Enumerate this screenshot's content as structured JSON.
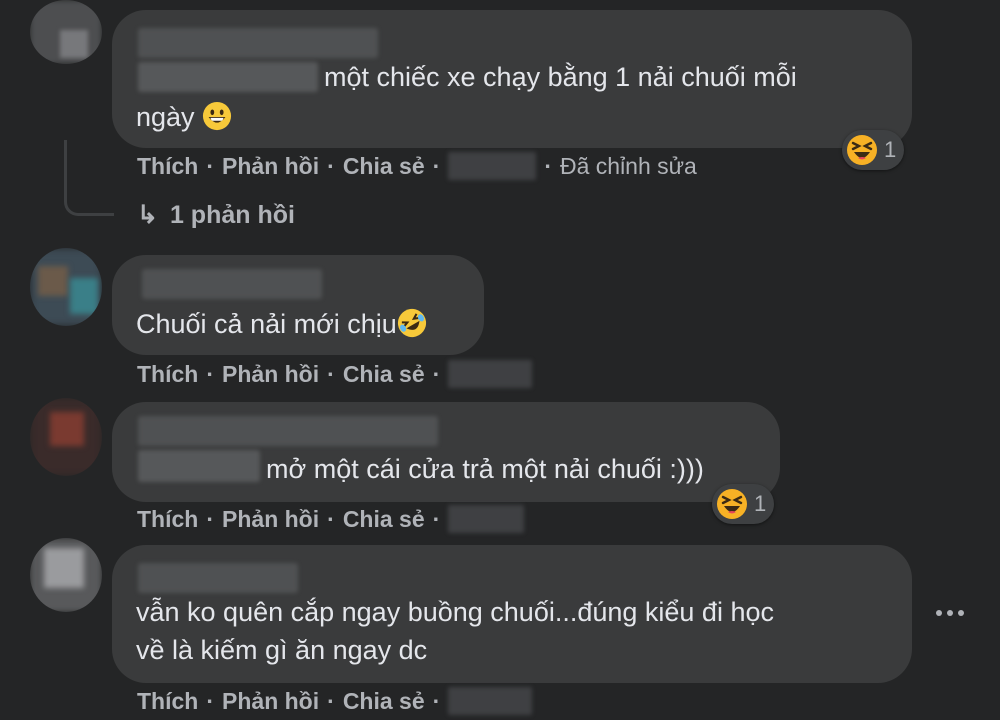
{
  "comments": [
    {
      "text_line1": "một chiếc xe chạy bằng 1 nải chuối mỗi",
      "text_line2": "ngày",
      "text_emoji": "grinning-face",
      "actions": {
        "like": "Thích",
        "reply": "Phản hồi",
        "share": "Chia sẻ",
        "edited": "Đã chỉnh sửa"
      },
      "reaction": {
        "icon": "laughing-squint-face",
        "count": "1"
      },
      "replies_label": "1 phản hồi"
    },
    {
      "text_line1": "Chuối cả nải mới chịu",
      "text_emoji": "rolling-on-floor-laughing",
      "actions": {
        "like": "Thích",
        "reply": "Phản hồi",
        "share": "Chia sẻ"
      }
    },
    {
      "text_line1": "mở một cái cửa trả một nải chuối :)))",
      "actions": {
        "like": "Thích",
        "reply": "Phản hồi",
        "share": "Chia sẻ"
      },
      "reaction": {
        "icon": "laughing-squint-face",
        "count": "1"
      }
    },
    {
      "text_line1": "vẫn ko quên cắp ngay buồng chuối...đúng kiểu đi học",
      "text_line2": "về là kiếm gì ăn ngay dc",
      "actions": {
        "like": "Thích",
        "reply": "Phản hồi",
        "share": "Chia sẻ"
      },
      "more_icon": "more-options-icon"
    }
  ],
  "separator": "·",
  "colors": {
    "background": "#242526",
    "bubble": "#3a3b3c",
    "text": "#e4e6eb",
    "secondary_text": "#b0b3b8",
    "reaction_yellow": "#f7b125"
  }
}
